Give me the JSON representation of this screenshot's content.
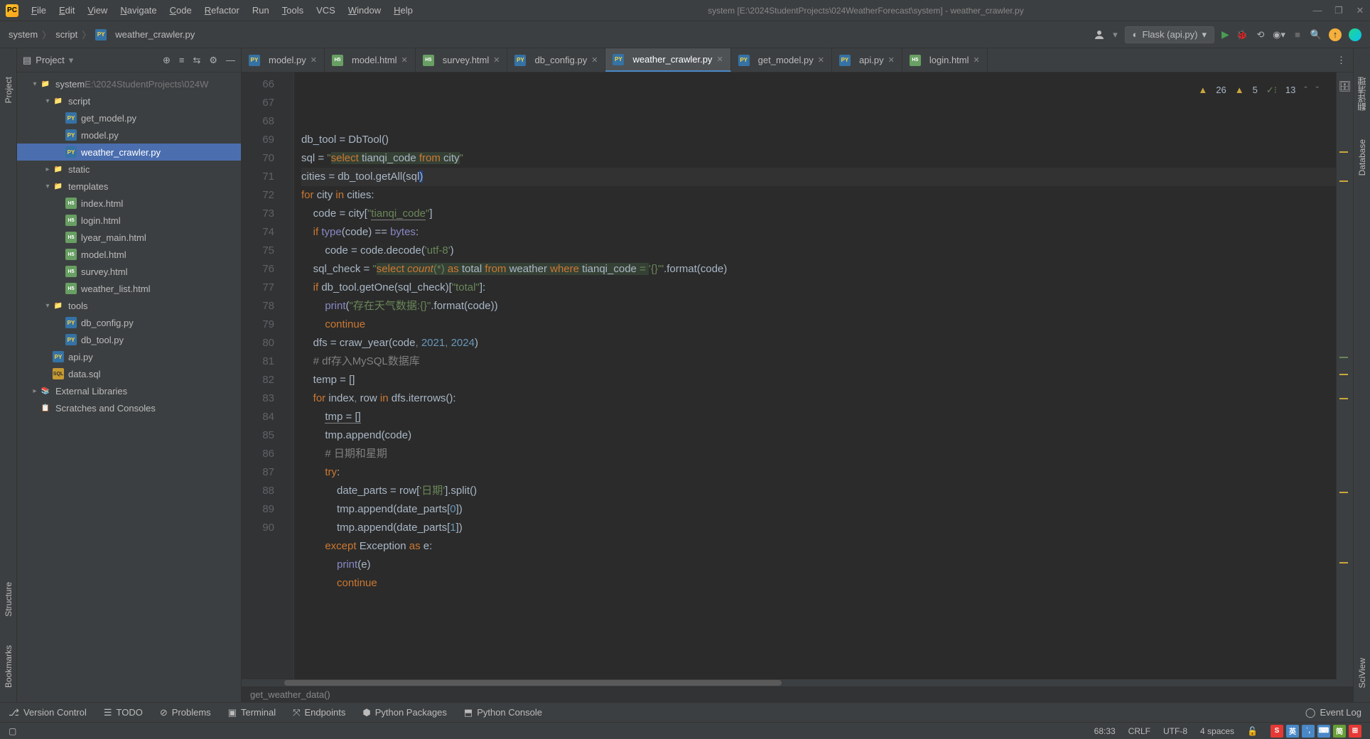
{
  "window": {
    "title": "system [E:\\2024StudentProjects\\024WeatherForecast\\system] - weather_crawler.py",
    "minimize": "—",
    "maximize": "❐",
    "close": "✕"
  },
  "menu": [
    {
      "label": "File",
      "u": "F"
    },
    {
      "label": "Edit",
      "u": "E"
    },
    {
      "label": "View",
      "u": "V"
    },
    {
      "label": "Navigate",
      "u": "N"
    },
    {
      "label": "Code",
      "u": "C"
    },
    {
      "label": "Refactor",
      "u": "R"
    },
    {
      "label": "Run",
      "u": ""
    },
    {
      "label": "Tools",
      "u": "T"
    },
    {
      "label": "VCS",
      "u": ""
    },
    {
      "label": "Window",
      "u": "W"
    },
    {
      "label": "Help",
      "u": "H"
    }
  ],
  "breadcrumbs": [
    "system",
    "script",
    "weather_crawler.py"
  ],
  "run_config": "Flask (api.py)",
  "left_strips": [
    "Project",
    "Structure",
    "Bookmarks"
  ],
  "right_strips": [
    "翻译清理",
    "Database",
    "SciView"
  ],
  "panel": {
    "title": "Project",
    "tree": [
      {
        "depth": 0,
        "chev": "▾",
        "icon": "folder",
        "label": "system",
        "suffix": "  E:\\2024StudentProjects\\024W"
      },
      {
        "depth": 1,
        "chev": "▾",
        "icon": "folder",
        "label": "script"
      },
      {
        "depth": 2,
        "chev": "",
        "icon": "py",
        "label": "get_model.py"
      },
      {
        "depth": 2,
        "chev": "",
        "icon": "py",
        "label": "model.py"
      },
      {
        "depth": 2,
        "chev": "",
        "icon": "py",
        "label": "weather_crawler.py",
        "selected": true
      },
      {
        "depth": 1,
        "chev": "▸",
        "icon": "folder",
        "label": "static"
      },
      {
        "depth": 1,
        "chev": "▾",
        "icon": "folder-p",
        "label": "templates"
      },
      {
        "depth": 2,
        "chev": "",
        "icon": "html",
        "label": "index.html"
      },
      {
        "depth": 2,
        "chev": "",
        "icon": "html",
        "label": "login.html"
      },
      {
        "depth": 2,
        "chev": "",
        "icon": "html",
        "label": "lyear_main.html"
      },
      {
        "depth": 2,
        "chev": "",
        "icon": "html",
        "label": "model.html"
      },
      {
        "depth": 2,
        "chev": "",
        "icon": "html",
        "label": "survey.html"
      },
      {
        "depth": 2,
        "chev": "",
        "icon": "html",
        "label": "weather_list.html"
      },
      {
        "depth": 1,
        "chev": "▾",
        "icon": "folder",
        "label": "tools"
      },
      {
        "depth": 2,
        "chev": "",
        "icon": "py",
        "label": "db_config.py"
      },
      {
        "depth": 2,
        "chev": "",
        "icon": "py",
        "label": "db_tool.py"
      },
      {
        "depth": 1,
        "chev": "",
        "icon": "py",
        "label": "api.py"
      },
      {
        "depth": 1,
        "chev": "",
        "icon": "sql",
        "label": "data.sql"
      },
      {
        "depth": 0,
        "chev": "▸",
        "icon": "lib",
        "label": "External Libraries"
      },
      {
        "depth": 0,
        "chev": "",
        "icon": "scratch",
        "label": "Scratches and Consoles"
      }
    ]
  },
  "tabs": [
    {
      "icon": "py",
      "label": "model.py"
    },
    {
      "icon": "html",
      "label": "model.html"
    },
    {
      "icon": "html",
      "label": "survey.html"
    },
    {
      "icon": "py",
      "label": "db_config.py"
    },
    {
      "icon": "py",
      "label": "weather_crawler.py",
      "active": true
    },
    {
      "icon": "py",
      "label": "get_model.py"
    },
    {
      "icon": "py",
      "label": "api.py"
    },
    {
      "icon": "html",
      "label": "login.html"
    }
  ],
  "inspections": {
    "warn1": "26",
    "warn2": "5",
    "typo": "13"
  },
  "code_lines": [
    {
      "n": 66,
      "html": "db_tool = DbTool()"
    },
    {
      "n": 67,
      "html": "sql = <span class='str'>\"</span><span class='sql-kw'>select</span><span class='strbg'> </span><span class='sql-col'>tianqi_code</span><span class='strbg'> </span><span class='sql-kw'>from</span><span class='strbg'> </span><span class='sql-col'>city</span><span class='str'>\"</span>"
    },
    {
      "n": 68,
      "html": "cities = db_tool.getAll(sql<span style='background:#214283'>)</span>",
      "hl": true
    },
    {
      "n": 69,
      "html": "<span class='kw'>for </span>city <span class='kw'>in </span>cities:"
    },
    {
      "n": 70,
      "html": "    code = city[<span class='str'>\"</span><span class='str param-u'>tianqi_code</span><span class='str'>\"</span>]"
    },
    {
      "n": 71,
      "html": "    <span class='kw'>if </span><span class='builtin'>type</span>(code) == <span class='builtin'>bytes</span>:"
    },
    {
      "n": 72,
      "html": "        code = code.decode(<span class='str'>'utf-8'</span>)"
    },
    {
      "n": 73,
      "html": "    sql_check = <span class='str'>\"</span><span class='sql-kw'>select</span><span class='strbg'> </span><span class='sql-fn'>count</span><span class='strbg'>(*) </span><span class='sql-kw'>as</span><span class='strbg'> </span><span class='sql-col'>total</span><span class='strbg'> </span><span class='sql-kw'>from</span><span class='strbg'> </span><span class='sql-col'>weather</span><span class='strbg'> </span><span class='sql-kw'>where</span><span class='strbg'> </span><span class='sql-col'>tianqi_code</span><span class='strbg'> = </span><span class='str'>'{}'</span><span class='str'>\"</span>.format(code)"
    },
    {
      "n": 74,
      "html": "    <span class='kw'>if </span>db_tool.getOne(sql_check)[<span class='str'>\"total\"</span>]:"
    },
    {
      "n": 75,
      "html": "        <span class='builtin'>print</span>(<span class='str'>\"存在天气数据:{}\"</span>.format(code))"
    },
    {
      "n": 76,
      "html": "        <span class='kw'>continue</span>"
    },
    {
      "n": 77,
      "html": "    dfs = craw_year(code<span class='cmt'>, </span><span class='num'>2021</span><span class='cmt'>, </span><span class='num'>2024</span>)"
    },
    {
      "n": 78,
      "html": "    <span class='cmt'># df存入MySQL数据库</span>"
    },
    {
      "n": 79,
      "html": "    temp = []"
    },
    {
      "n": 80,
      "html": "    <span class='kw'>for </span>index<span class='cmt'>, </span>row <span class='kw'>in </span>dfs.iterrows():"
    },
    {
      "n": 81,
      "html": "        <span class='param-u'>tmp = []</span>"
    },
    {
      "n": 82,
      "html": "        tmp.append(code)"
    },
    {
      "n": 83,
      "html": "        <span class='cmt'># 日期和星期</span>"
    },
    {
      "n": 84,
      "html": "        <span class='kw'>try</span>:"
    },
    {
      "n": 85,
      "html": "            date_parts = row[<span class='str'>'日期'</span>].split()"
    },
    {
      "n": 86,
      "html": "            tmp.append(date_parts[<span class='num'>0</span>])"
    },
    {
      "n": 87,
      "html": "            tmp.append(date_parts[<span class='num'>1</span>])"
    },
    {
      "n": 88,
      "html": "        <span class='kw'>except </span>Exception <span class='kw'>as </span>e:"
    },
    {
      "n": 89,
      "html": "            <span class='builtin'>print</span>(e)"
    },
    {
      "n": 90,
      "html": "            <span class='kw'>continue</span>"
    }
  ],
  "breadcrumb_bottom": "get_weather_data()",
  "bottom_tools": [
    {
      "icon": "⎇",
      "label": "Version Control"
    },
    {
      "icon": "☰",
      "label": "TODO"
    },
    {
      "icon": "⊘",
      "label": "Problems"
    },
    {
      "icon": "▣",
      "label": "Terminal"
    },
    {
      "icon": "⤧",
      "label": "Endpoints"
    },
    {
      "icon": "⬢",
      "label": "Python Packages"
    },
    {
      "icon": "⬒",
      "label": "Python Console"
    }
  ],
  "event_log": "Event Log",
  "status": {
    "pos": "68:33",
    "crlf": "CRLF",
    "enc": "UTF-8",
    "indent": "4 spaces"
  }
}
